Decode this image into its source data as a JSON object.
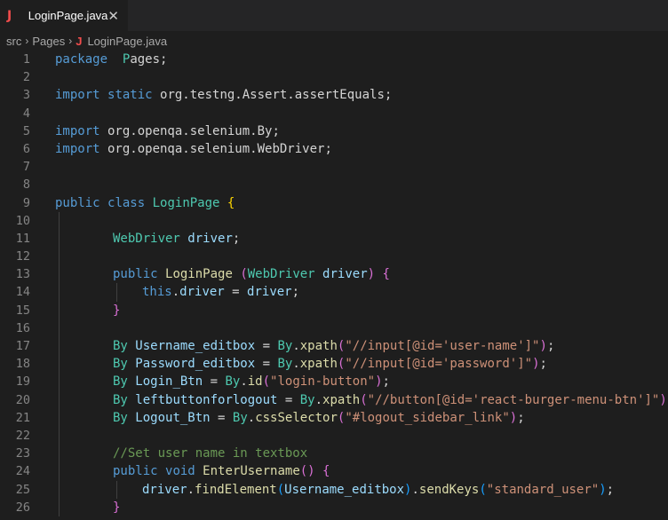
{
  "tab": {
    "icon": "J",
    "title": "LoginPage.java",
    "close": "✕"
  },
  "breadcrumb": {
    "items": [
      "src",
      "Pages"
    ],
    "file_icon": "J",
    "file": "LoginPage.java",
    "separator": "›"
  },
  "colors": {
    "keyword": "#569cd6",
    "type": "#4ec9b0",
    "function": "#dcdcaa",
    "variable": "#9cdcfe",
    "string": "#ce9178",
    "comment": "#6a9955",
    "bracket": "#ffd700"
  },
  "lines": [
    {
      "n": "1",
      "indent": 0,
      "tokens": [
        [
          "kw",
          "package"
        ],
        [
          "",
          "  "
        ],
        [
          "cls",
          "P"
        ],
        [
          "",
          "ages;"
        ]
      ]
    },
    {
      "n": "2",
      "indent": 0,
      "tokens": []
    },
    {
      "n": "3",
      "indent": 0,
      "tokens": [
        [
          "kw",
          "import"
        ],
        [
          "",
          " "
        ],
        [
          "kw",
          "static"
        ],
        [
          "",
          " org.testng.Assert.assertEquals;"
        ]
      ]
    },
    {
      "n": "4",
      "indent": 0,
      "tokens": []
    },
    {
      "n": "5",
      "indent": 0,
      "tokens": [
        [
          "kw",
          "import"
        ],
        [
          "",
          " org.openqa.selenium.By;"
        ]
      ]
    },
    {
      "n": "6",
      "indent": 0,
      "tokens": [
        [
          "kw",
          "import"
        ],
        [
          "",
          " org.openqa.selenium.WebDriver;"
        ]
      ]
    },
    {
      "n": "7",
      "indent": 0,
      "tokens": []
    },
    {
      "n": "8",
      "indent": 0,
      "tokens": []
    },
    {
      "n": "9",
      "indent": 0,
      "tokens": [
        [
          "kw",
          "public"
        ],
        [
          "",
          " "
        ],
        [
          "kw",
          "class"
        ],
        [
          "",
          " "
        ],
        [
          "cls",
          "LoginPage"
        ],
        [
          "",
          " "
        ],
        [
          "br",
          "{"
        ]
      ]
    },
    {
      "n": "10",
      "indent": 0,
      "tokens": []
    },
    {
      "n": "11",
      "indent": 1,
      "tokens": [
        [
          "cls",
          "WebDriver"
        ],
        [
          "",
          " "
        ],
        [
          "var",
          "driver"
        ],
        [
          "",
          ";"
        ]
      ]
    },
    {
      "n": "12",
      "indent": 1,
      "tokens": []
    },
    {
      "n": "13",
      "indent": 1,
      "tokens": [
        [
          "kw",
          "public"
        ],
        [
          "",
          " "
        ],
        [
          "fn",
          "LoginPage"
        ],
        [
          "",
          " "
        ],
        [
          "br2",
          "("
        ],
        [
          "cls",
          "WebDriver"
        ],
        [
          "",
          " "
        ],
        [
          "var",
          "driver"
        ],
        [
          "br2",
          ")"
        ],
        [
          "",
          " "
        ],
        [
          "br2",
          "{"
        ]
      ]
    },
    {
      "n": "14",
      "indent": 2,
      "tokens": [
        [
          "kw",
          "this"
        ],
        [
          "",
          "."
        ],
        [
          "var",
          "driver"
        ],
        [
          "",
          " = "
        ],
        [
          "var",
          "driver"
        ],
        [
          "",
          ";"
        ]
      ]
    },
    {
      "n": "15",
      "indent": 1,
      "tokens": [
        [
          "br2",
          "}"
        ]
      ]
    },
    {
      "n": "16",
      "indent": 1,
      "tokens": []
    },
    {
      "n": "17",
      "indent": 1,
      "tokens": [
        [
          "cls",
          "By"
        ],
        [
          "",
          " "
        ],
        [
          "var",
          "Username_editbox"
        ],
        [
          "",
          " = "
        ],
        [
          "cls",
          "By"
        ],
        [
          "",
          "."
        ],
        [
          "fn",
          "xpath"
        ],
        [
          "br2",
          "("
        ],
        [
          "str",
          "\"//input[@id='user-name']\""
        ],
        [
          "br2",
          ")"
        ],
        [
          "",
          ";"
        ]
      ]
    },
    {
      "n": "18",
      "indent": 1,
      "tokens": [
        [
          "cls",
          "By"
        ],
        [
          "",
          " "
        ],
        [
          "var",
          "Password_editbox"
        ],
        [
          "",
          " = "
        ],
        [
          "cls",
          "By"
        ],
        [
          "",
          "."
        ],
        [
          "fn",
          "xpath"
        ],
        [
          "br2",
          "("
        ],
        [
          "str",
          "\"//input[@id='password']\""
        ],
        [
          "br2",
          ")"
        ],
        [
          "",
          ";"
        ]
      ]
    },
    {
      "n": "19",
      "indent": 1,
      "tokens": [
        [
          "cls",
          "By"
        ],
        [
          "",
          " "
        ],
        [
          "var",
          "Login_Btn"
        ],
        [
          "",
          " = "
        ],
        [
          "cls",
          "By"
        ],
        [
          "",
          "."
        ],
        [
          "fn",
          "id"
        ],
        [
          "br2",
          "("
        ],
        [
          "str",
          "\"login-button\""
        ],
        [
          "br2",
          ")"
        ],
        [
          "",
          ";"
        ]
      ]
    },
    {
      "n": "20",
      "indent": 1,
      "tokens": [
        [
          "cls",
          "By"
        ],
        [
          "",
          " "
        ],
        [
          "var",
          "leftbuttonforlogout"
        ],
        [
          "",
          " = "
        ],
        [
          "cls",
          "By"
        ],
        [
          "",
          "."
        ],
        [
          "fn",
          "xpath"
        ],
        [
          "br2",
          "("
        ],
        [
          "str",
          "\"//button[@id='react-burger-menu-btn']\""
        ],
        [
          "br2",
          ")"
        ],
        [
          "",
          ";"
        ]
      ]
    },
    {
      "n": "21",
      "indent": 1,
      "tokens": [
        [
          "cls",
          "By"
        ],
        [
          "",
          " "
        ],
        [
          "var",
          "Logout_Btn"
        ],
        [
          "",
          " = "
        ],
        [
          "cls",
          "By"
        ],
        [
          "",
          "."
        ],
        [
          "fn",
          "cssSelector"
        ],
        [
          "br2",
          "("
        ],
        [
          "str",
          "\"#logout_sidebar_link\""
        ],
        [
          "br2",
          ")"
        ],
        [
          "",
          ";"
        ]
      ]
    },
    {
      "n": "22",
      "indent": 1,
      "tokens": []
    },
    {
      "n": "23",
      "indent": 1,
      "tokens": [
        [
          "cmt",
          "//Set user name in textbox"
        ]
      ]
    },
    {
      "n": "24",
      "indent": 1,
      "tokens": [
        [
          "kw",
          "public"
        ],
        [
          "",
          " "
        ],
        [
          "kw",
          "void"
        ],
        [
          "",
          " "
        ],
        [
          "fn",
          "EnterUsername"
        ],
        [
          "br2",
          "()"
        ],
        [
          "",
          " "
        ],
        [
          "br2",
          "{"
        ]
      ]
    },
    {
      "n": "25",
      "indent": 2,
      "tokens": [
        [
          "var",
          "driver"
        ],
        [
          "",
          "."
        ],
        [
          "fn",
          "findElement"
        ],
        [
          "br3",
          "("
        ],
        [
          "var",
          "Username_editbox"
        ],
        [
          "br3",
          ")"
        ],
        [
          "",
          "."
        ],
        [
          "fn",
          "sendKeys"
        ],
        [
          "br3",
          "("
        ],
        [
          "str",
          "\"standard_user\""
        ],
        [
          "br3",
          ")"
        ],
        [
          "",
          ";"
        ]
      ]
    },
    {
      "n": "26",
      "indent": 1,
      "tokens": [
        [
          "br2",
          "}"
        ]
      ]
    }
  ]
}
